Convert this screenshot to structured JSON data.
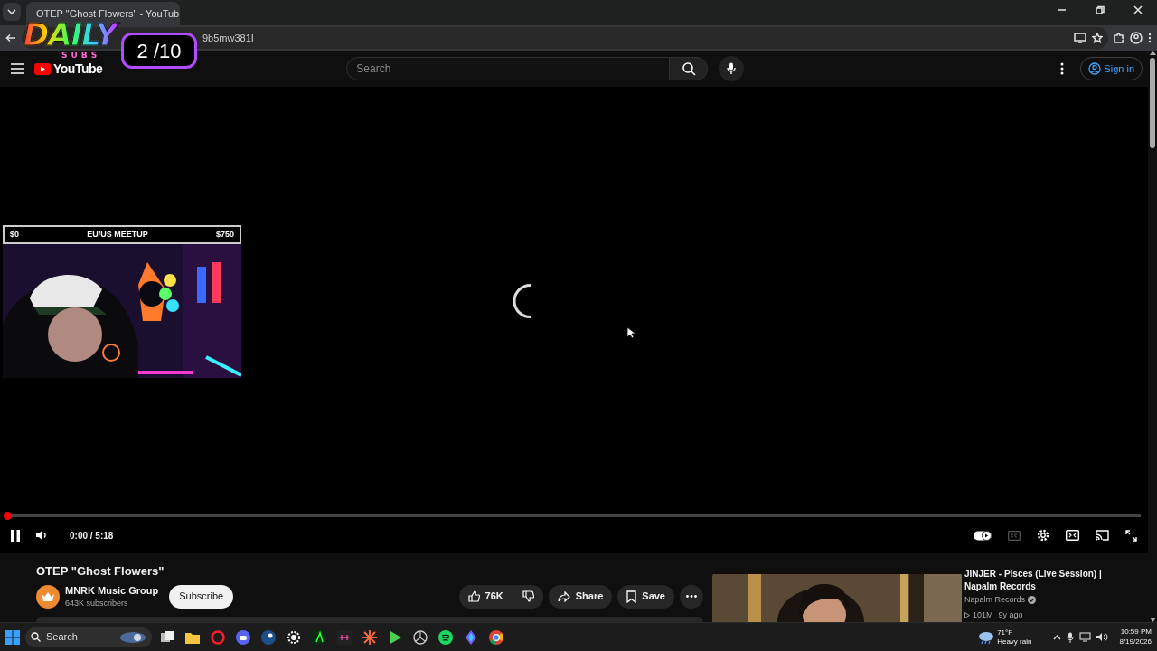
{
  "browser": {
    "tab": {
      "title": "OTEP \"Ghost Flowers\" - YouTub",
      "selected": true
    },
    "address": "9b5mw381I"
  },
  "overlay": {
    "logo_text": "DAILY",
    "logo_subtext": "SUBS",
    "counter": "2 /10"
  },
  "webcam": {
    "goal_start": "$0",
    "goal_title": "EU/US MEETUP",
    "goal_end": "$750"
  },
  "header": {
    "logo": "YouTube",
    "search_placeholder": "Search",
    "sign_in": "Sign in"
  },
  "player": {
    "progress": {
      "level": 0
    },
    "playing": true,
    "time": "0:00 / 5:18",
    "autoplay": true,
    "captions_available": false
  },
  "video": {
    "title": "OTEP \"Ghost Flowers\"",
    "channel": "MNRK Music Group",
    "subscribers": "643K subscribers",
    "subscribe": "Subscribe",
    "likes": "76K",
    "share": "Share",
    "save": "Save"
  },
  "recommended": [
    {
      "title": "JINJER - Pisces (Live Session) | Napalm Records",
      "channel": "Napalm Records",
      "verified": true,
      "views": "101M",
      "age": "9y ago"
    }
  ],
  "taskbar": {
    "search_placeholder": "Search",
    "weather": {
      "temp": "71°F",
      "condition": "Heavy rain"
    },
    "time": "10:59 PM",
    "date": "8/19/2026"
  }
}
